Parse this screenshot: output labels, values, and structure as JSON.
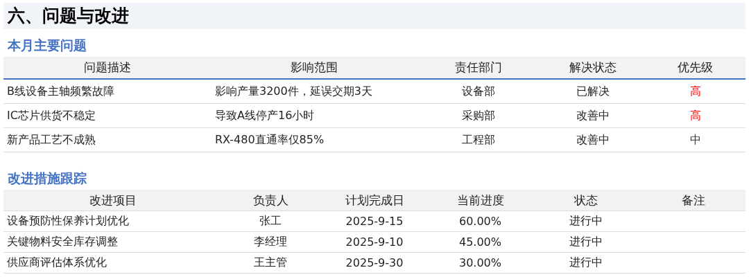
{
  "title": "六、问题与改进",
  "issues": {
    "heading": "本月主要问题",
    "columns": [
      "问题描述",
      "影响范围",
      "责任部门",
      "解决状态",
      "优先级"
    ],
    "rows": [
      {
        "description": "B线设备主轴频繁故障",
        "impact": "影响产量3200件，延误交期3天",
        "department": "设备部",
        "status": "已解决",
        "priority": {
          "text": "高",
          "color": "#ff0000"
        }
      },
      {
        "description": "IC芯片供货不稳定",
        "impact": "导致A线停产16小时",
        "department": "采购部",
        "status": "改善中",
        "priority": {
          "text": "高",
          "color": "#ff0000"
        }
      },
      {
        "description": "新产品工艺不成熟",
        "impact": "RX-480直通率仅85%",
        "department": "工程部",
        "status": "改善中",
        "priority": {
          "text": "中",
          "color": "#333333"
        }
      }
    ]
  },
  "actions": {
    "heading": "改进措施跟踪",
    "columns": [
      "改进项目",
      "负责人",
      "计划完成日",
      "当前进度",
      "状态",
      "备注"
    ],
    "rows": [
      {
        "item": "设备预防性保养计划优化",
        "owner": "张工",
        "due": "2025-9-15",
        "progress": "60.00%",
        "status": "进行中"
      },
      {
        "item": "关键物料安全库存调整",
        "owner": "李经理",
        "due": "2025-9-10",
        "progress": "45.00%",
        "status": "进行中"
      },
      {
        "item": "供应商评估体系优化",
        "owner": "王主管",
        "due": "2025-9-30",
        "progress": "30.00%",
        "status": "进行中"
      }
    ]
  }
}
